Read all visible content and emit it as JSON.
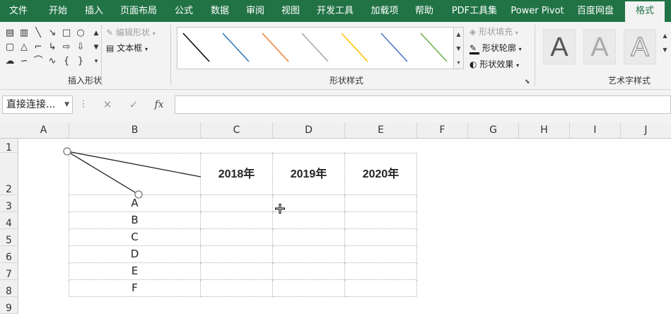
{
  "ribbon_tabs": [
    "文件",
    "开始",
    "插入",
    "页面布局",
    "公式",
    "数据",
    "审阅",
    "视图",
    "开发工具",
    "加载项",
    "帮助",
    "PDF工具集",
    "Power Pivot",
    "百度网盘",
    "格式"
  ],
  "ribbon": {
    "insert_shapes": {
      "edit_shape": "编辑形状",
      "text_box": "文本框",
      "label": "插入形状"
    },
    "shape_styles": {
      "fill": "形状填充",
      "outline": "形状轮廓",
      "effects": "形状效果",
      "label": "形状样式",
      "line_colors": [
        "#000000",
        "#2e75b6",
        "#ed7d31",
        "#a5a5a5",
        "#ffc000",
        "#4472c4",
        "#70ad47"
      ]
    },
    "wordart": {
      "glyphs": [
        "A",
        "A",
        "A"
      ],
      "label": "艺术字样式"
    }
  },
  "formula_bar": {
    "name_box": "直接连接...",
    "cancel_icon": "✕",
    "enter_icon": "✓",
    "fx_label": "fx",
    "value": ""
  },
  "sheet": {
    "columns": [
      "A",
      "B",
      "C",
      "D",
      "E",
      "F",
      "G",
      "H",
      "I",
      "J"
    ],
    "rows": [
      "1",
      "2",
      "3",
      "4",
      "5",
      "6",
      "7",
      "8",
      "9"
    ],
    "years": [
      "2018年",
      "2019年",
      "2020年"
    ],
    "labels": [
      "A",
      "B",
      "C",
      "D",
      "E",
      "F"
    ]
  },
  "colors": {
    "ribbon_green": "#217346",
    "ribbon_bg": "#f3f3f3"
  }
}
